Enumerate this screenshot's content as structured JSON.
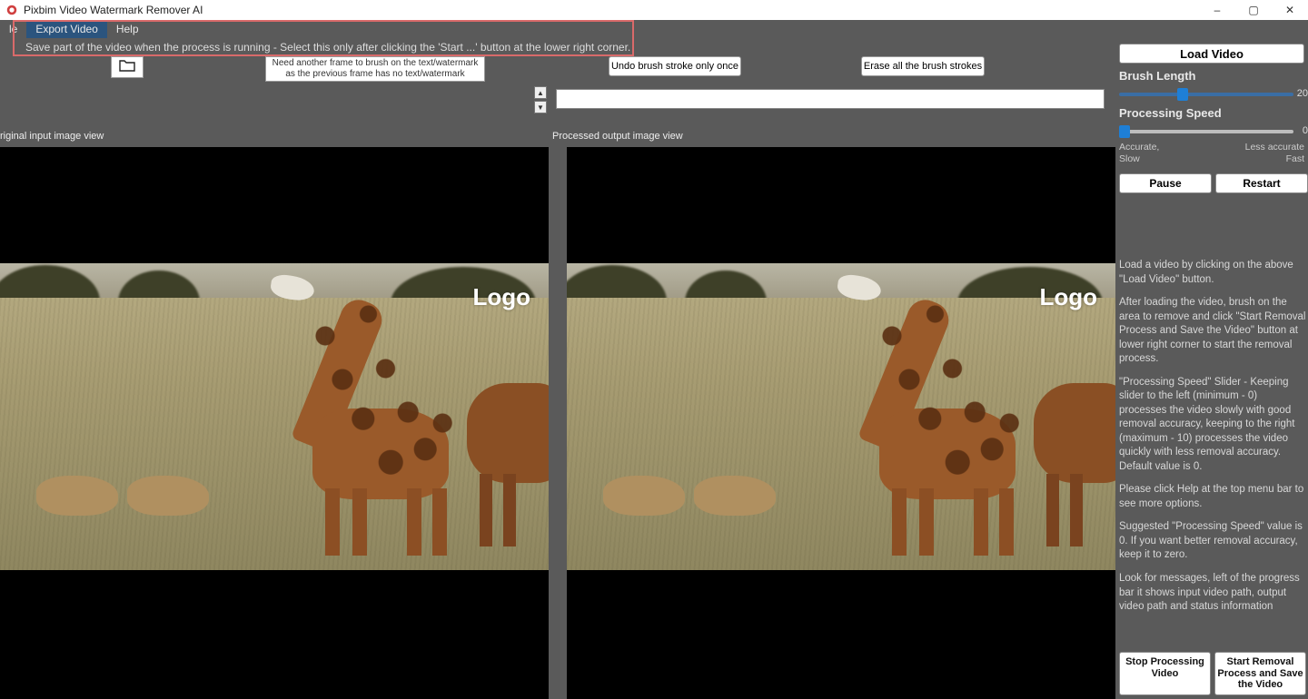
{
  "window": {
    "title": "Pixbim Video Watermark Remover AI"
  },
  "menu": {
    "file": "le",
    "export": "Export Video",
    "help": "Help",
    "tooltip": "Save part of the video when the process is running - Select this only after clicking the 'Start ...' button at the lower right corner."
  },
  "toolbar": {
    "need_frame": "Need another frame to brush on the text/watermark as the previous frame has no text/watermark",
    "undo": "Undo brush stroke only once",
    "erase": "Erase all the brush strokes"
  },
  "views": {
    "left": "riginal input image view",
    "right": "Processed output image view",
    "logo_text": "Logo"
  },
  "side": {
    "load": "Load Video",
    "brush_label": "Brush Length",
    "brush_max": "20",
    "speed_label": "Processing Speed",
    "speed_max": "0",
    "speed_left_a": "Accurate,",
    "speed_left_b": "Slow",
    "speed_right_a": "Less accurate",
    "speed_right_b": "Fast",
    "pause": "Pause",
    "restart": "Restart",
    "p1": "Load a video by clicking on the above \"Load Video\" button.",
    "p2": "After loading the video, brush on the area to remove and click \"Start Removal Process and Save the Video\" button at lower right corner to start the removal process.",
    "p3": "\"Processing Speed\" Slider - Keeping slider to the left (minimum - 0) processes the video slowly with good removal accuracy, keeping to the right (maximum - 10) processes the video quickly with less removal accuracy. Default value is 0.",
    "p4": "Please click Help at the top menu bar to see more options.",
    "p5": "Suggested \"Processing Speed\" value is 0. If you want better removal accuracy, keep it to zero.",
    "p6": "Look for messages, left of the progress bar it shows input video path, output video path and status information",
    "stop": "Stop Processing Video",
    "start": "Start Removal Process and Save the Video"
  },
  "sliders": {
    "brush_length": {
      "min": 0,
      "max": 20,
      "value": 7
    },
    "processing_speed": {
      "min": 0,
      "max": 10,
      "value": 0
    }
  },
  "colors": {
    "accent": "#1e7fd6",
    "highlight": "#d96a6a"
  }
}
